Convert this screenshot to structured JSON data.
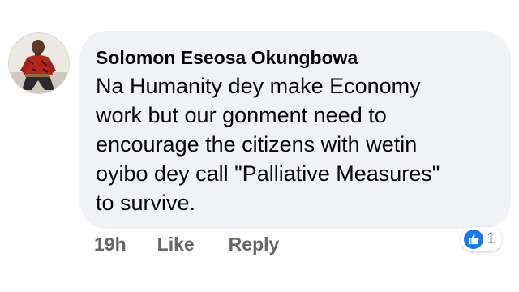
{
  "comment": {
    "author": "Solomon Eseosa Okungbowa",
    "text_lines": [
      "Na Humanity dey make Economy",
      "work but our gonment need to",
      "encourage the citizens with wetin",
      "oyibo dey call \"Palliative Measures\"",
      "to survive."
    ],
    "timestamp": "19h",
    "like_label": "Like",
    "reply_label": "Reply",
    "reaction": {
      "icon": "thumbs-up-icon",
      "count": "1",
      "color": "#1877f2"
    }
  }
}
